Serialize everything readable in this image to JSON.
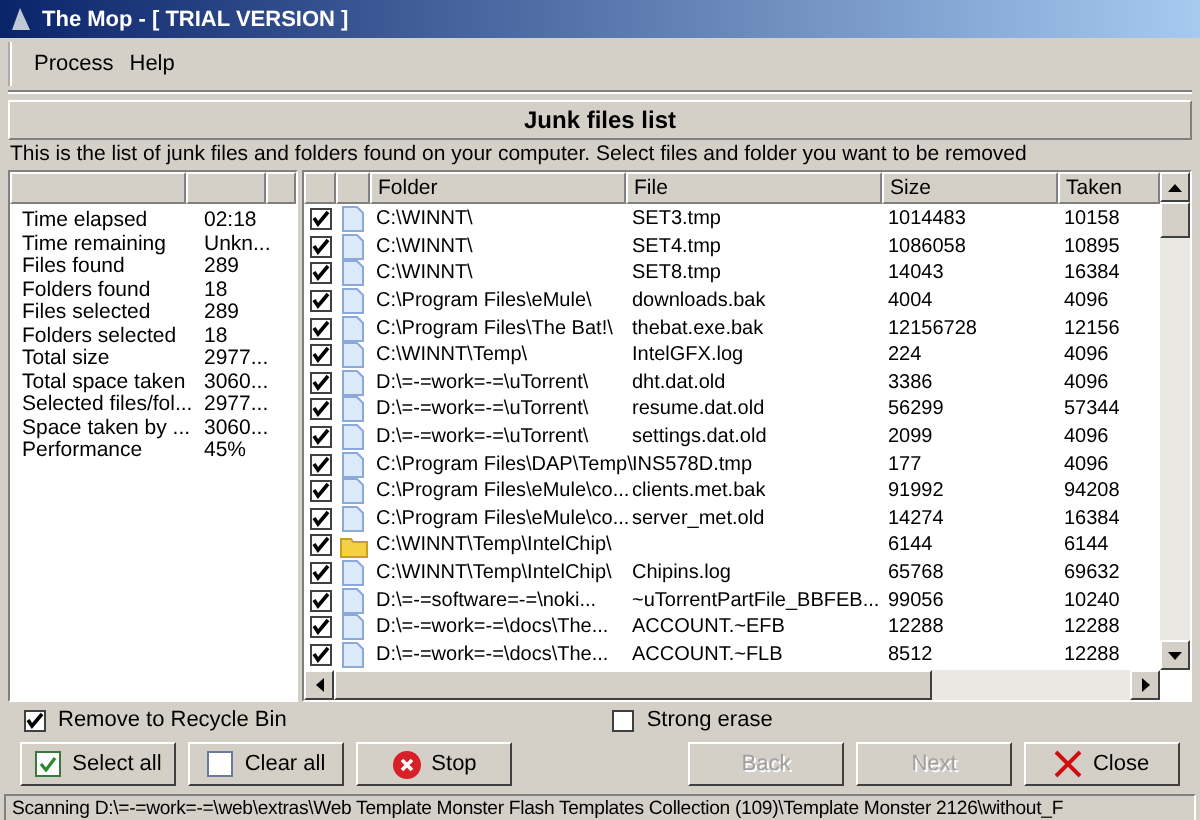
{
  "window": {
    "title": "The Mop - [ TRIAL VERSION ]"
  },
  "menu": [
    "Process",
    "Help"
  ],
  "header": "Junk files list",
  "description": "This is the list of junk files and folders found on your computer. Select files and folder you want to be removed",
  "stats": [
    {
      "label": "Time elapsed",
      "value": "02:18"
    },
    {
      "label": "Time remaining",
      "value": "Unkn..."
    },
    {
      "label": "Files found",
      "value": "289"
    },
    {
      "label": "Folders found",
      "value": "18"
    },
    {
      "label": "Files selected",
      "value": "289"
    },
    {
      "label": "Folders selected",
      "value": "18"
    },
    {
      "label": "Total size",
      "value": "2977..."
    },
    {
      "label": "Total space taken",
      "value": "3060..."
    },
    {
      "label": "Selected files/fol...",
      "value": "2977..."
    },
    {
      "label": "Space taken by ...",
      "value": "3060..."
    },
    {
      "label": "Performance",
      "value": "45%"
    }
  ],
  "table": {
    "columns": [
      "Folder",
      "File",
      "Size",
      "Taken"
    ],
    "rows": [
      {
        "kind": "file",
        "checked": true,
        "folder": "C:\\WINNT\\",
        "file": "SET3.tmp",
        "size": "1014483",
        "taken": "10158"
      },
      {
        "kind": "file",
        "checked": true,
        "folder": "C:\\WINNT\\",
        "file": "SET4.tmp",
        "size": "1086058",
        "taken": "10895"
      },
      {
        "kind": "file",
        "checked": true,
        "folder": "C:\\WINNT\\",
        "file": "SET8.tmp",
        "size": "14043",
        "taken": "16384"
      },
      {
        "kind": "file",
        "checked": true,
        "folder": "C:\\Program Files\\eMule\\",
        "file": "downloads.bak",
        "size": "4004",
        "taken": "4096"
      },
      {
        "kind": "file",
        "checked": true,
        "folder": "C:\\Program Files\\The Bat!\\",
        "file": "thebat.exe.bak",
        "size": "12156728",
        "taken": "12156"
      },
      {
        "kind": "file",
        "checked": true,
        "folder": "C:\\WINNT\\Temp\\",
        "file": "IntelGFX.log",
        "size": "224",
        "taken": "4096"
      },
      {
        "kind": "file",
        "checked": true,
        "folder": "D:\\=-=work=-=\\uTorrent\\",
        "file": "dht.dat.old",
        "size": "3386",
        "taken": "4096"
      },
      {
        "kind": "file",
        "checked": true,
        "folder": "D:\\=-=work=-=\\uTorrent\\",
        "file": "resume.dat.old",
        "size": "56299",
        "taken": "57344"
      },
      {
        "kind": "file",
        "checked": true,
        "folder": "D:\\=-=work=-=\\uTorrent\\",
        "file": "settings.dat.old",
        "size": "2099",
        "taken": "4096"
      },
      {
        "kind": "file",
        "checked": true,
        "folder": "C:\\Program Files\\DAP\\Temp\\",
        "file": "INS578D.tmp",
        "size": "177",
        "taken": "4096"
      },
      {
        "kind": "file",
        "checked": true,
        "folder": "C:\\Program Files\\eMule\\co...",
        "file": "clients.met.bak",
        "size": "91992",
        "taken": "94208"
      },
      {
        "kind": "file",
        "checked": true,
        "folder": "C:\\Program Files\\eMule\\co...",
        "file": "server_met.old",
        "size": "14274",
        "taken": "16384"
      },
      {
        "kind": "folder",
        "checked": true,
        "folder": "C:\\WINNT\\Temp\\IntelChip\\",
        "size": "6144",
        "taken": "6144"
      },
      {
        "kind": "file",
        "checked": true,
        "folder": "C:\\WINNT\\Temp\\IntelChip\\",
        "file": "Chipins.log",
        "size": "65768",
        "taken": "69632"
      },
      {
        "kind": "file",
        "checked": true,
        "folder": "D:\\=-=software=-=\\noki...",
        "file": "~uTorrentPartFile_BBFEB...",
        "size": "99056",
        "taken": "10240"
      },
      {
        "kind": "file",
        "checked": true,
        "folder": "D:\\=-=work=-=\\docs\\The...",
        "file": "ACCOUNT.~EFB",
        "size": "12288",
        "taken": "12288"
      },
      {
        "kind": "file",
        "checked": true,
        "folder": "D:\\=-=work=-=\\docs\\The...",
        "file": "ACCOUNT.~FLB",
        "size": "8512",
        "taken": "12288"
      }
    ]
  },
  "options": [
    {
      "label": "Remove to Recycle Bin",
      "checked": true
    },
    {
      "label": "Strong erase",
      "checked": false
    }
  ],
  "buttons": [
    {
      "kind": "check",
      "label": "Select all",
      "disabled": false
    },
    {
      "kind": "uncheck",
      "label": "Clear all",
      "disabled": false
    },
    {
      "kind": "stop",
      "label": "Stop",
      "disabled": false
    },
    {
      "kind": "plain",
      "label": "Back",
      "disabled": true
    },
    {
      "kind": "plain",
      "label": "Next",
      "disabled": true
    },
    {
      "kind": "close",
      "label": "Close",
      "disabled": false
    }
  ],
  "status_bar": "Scanning D:\\=-=work=-=\\web\\extras\\Web Template Monster Flash Templates Collection (109)\\Template Monster 2126\\without_F"
}
